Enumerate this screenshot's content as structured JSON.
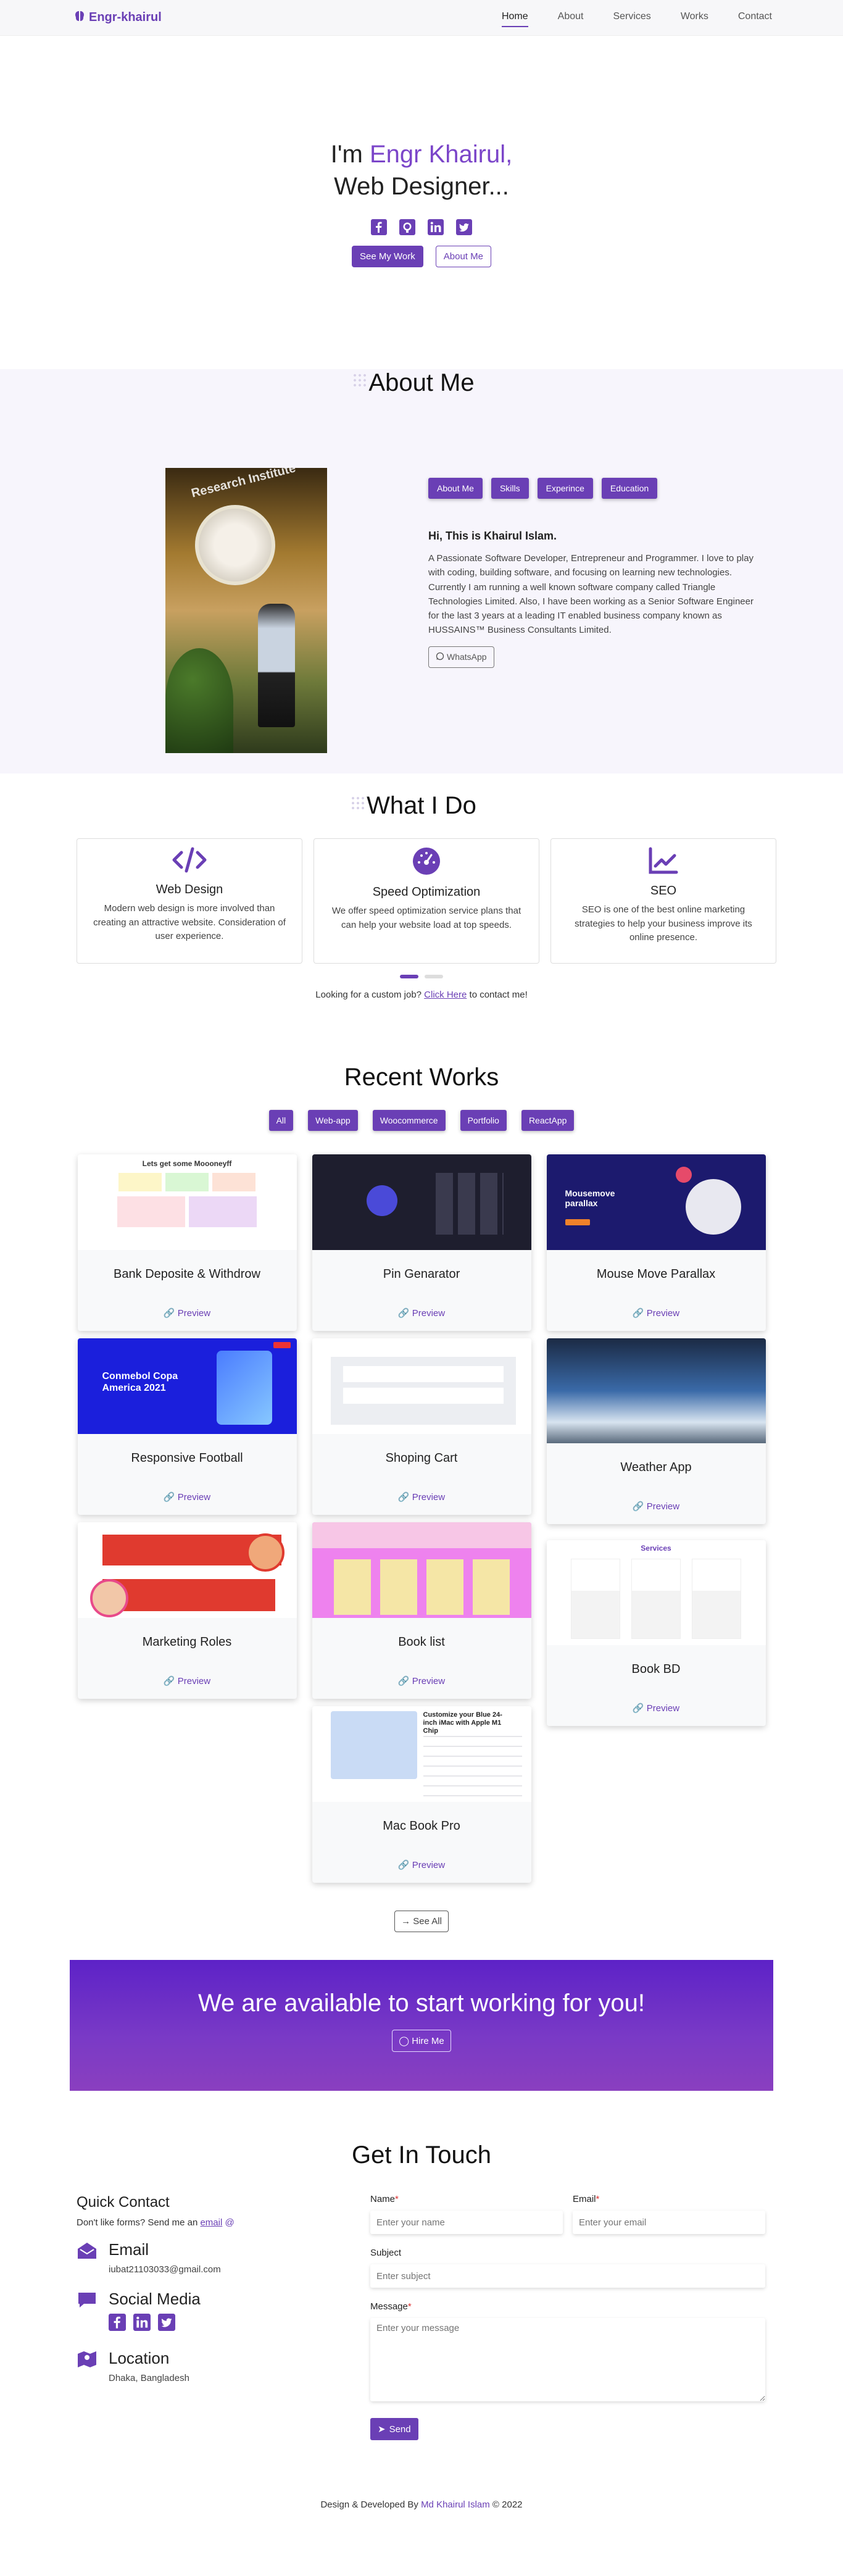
{
  "nav": {
    "brand": "Engr-khairul",
    "links": [
      "Home",
      "About",
      "Services",
      "Works",
      "Contact"
    ]
  },
  "hero": {
    "line1_prefix": "I'm ",
    "line1_name": "Engr Khairul,",
    "line2": "Web Designer...",
    "btn_work": "See My Work",
    "btn_about": "About Me"
  },
  "about": {
    "title": "About Me",
    "tabs": [
      "About Me",
      "Skills",
      "Experince",
      "Education"
    ],
    "heading": "Hi, This is Khairul Islam.",
    "text": "A Passionate Software Developer, Entrepreneur and Programmer. I love to play with coding, building software, and focusing on learning new technologies. Currently I am running a well known software company called Triangle Technologies Limited. Also, I have been working as a Senior Software Engineer for the last 3 years at a leading IT enabled business company known as HUSSAINS™ Business Consultants Limited.",
    "whatsapp": "WhatsApp"
  },
  "services": {
    "title": "What I Do",
    "items": [
      {
        "title": "Web Design",
        "text": "Modern web design is more involved than creating an attractive website. Consideration of user experience."
      },
      {
        "title": "Speed Optimization",
        "text": "We offer speed optimization service plans that can help your website load at top speeds."
      },
      {
        "title": "SEO",
        "text": "SEO is one of the best online marketing strategies to help your business improve its online presence."
      }
    ],
    "custom_prefix": "Looking for a custom job? ",
    "custom_link": "Click Here",
    "custom_suffix": " to contact me!"
  },
  "works": {
    "title": "Recent Works",
    "filters": [
      "All",
      "Web-app",
      "Woocommerce",
      "Portfolio",
      "ReactApp"
    ],
    "preview_label": "Preview",
    "items": [
      {
        "title": "Bank Deposite & Withdrow"
      },
      {
        "title": "Pin Genarator"
      },
      {
        "title": "Mouse Move Parallax"
      },
      {
        "title": "Responsive Football"
      },
      {
        "title": "Shoping Cart"
      },
      {
        "title": "Weather App"
      },
      {
        "title": "Marketing Roles"
      },
      {
        "title": "Book list"
      },
      {
        "title": "Book BD"
      },
      {
        "title": "Mac Book Pro"
      }
    ],
    "see_all": "See All",
    "thumb_text": {
      "bank": "Lets get some Moooneyff",
      "parallax": "Mousemove parallax",
      "football": "Conmebol Copa America 2021",
      "books": "Services",
      "mac": "Customize your Blue 24-inch iMac with Apple M1 Chip"
    }
  },
  "banner": {
    "title": "We are available to start working for you!",
    "button": "Hire Me"
  },
  "contact": {
    "title": "Get In Touch",
    "quick": "Quick Contact",
    "dont_like": "Don't like forms? Send me an ",
    "email_link": "email",
    "email_label": "Email",
    "email_value": "iubat21103033@gmail.com",
    "social_label": "Social Media",
    "location_label": "Location",
    "location_value": "Dhaka, Bangladesh",
    "form": {
      "name_label": "Name",
      "name_placeholder": "Enter your name",
      "email_label": "Email",
      "email_placeholder": "Enter your email",
      "subject_label": "Subject",
      "subject_placeholder": "Enter subject",
      "message_label": "Message",
      "message_placeholder": "Enter your message",
      "send": "Send"
    }
  },
  "footer": {
    "prefix": "Design & Developed By ",
    "author": "Md Khairul Islam",
    "suffix": " © 2022"
  },
  "colors": {
    "accent": "#6a3fb5",
    "about_bg": "#f7f5fc",
    "banner": "#5d22c7"
  }
}
